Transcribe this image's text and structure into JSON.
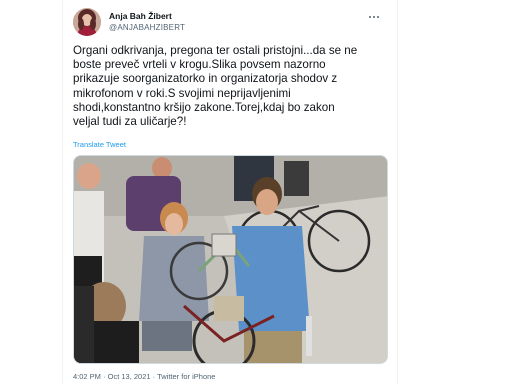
{
  "tweet": {
    "author": {
      "display_name": "Anja Bah Žibert",
      "handle": "@ANJABAHZIBERT"
    },
    "text": "Organi odkrivanja, pregona ter ostali pristojni...da se ne\nboste preveč vrteli v krogu.Slika povsem nazorno\nprikazuje soorganizatorko in organizatorja shodov z\nmikrofonom v roki.S svojimi neprijavljenimi\nshodi,konstantno kršijo zakone.Torej,kdaj bo zakon\nveljal tudi za uličarje?!",
    "translate_label": "Translate Tweet",
    "meta": {
      "time": "4:02 PM",
      "separator": " · ",
      "date": "Oct 13, 2021",
      "source": "Twitter for iPhone"
    }
  },
  "icons": {
    "more": "more-horizontal-icon",
    "avatar": "avatar"
  },
  "colors": {
    "link": "#1d9bf0",
    "secondary_text": "#536471",
    "primary_text": "#0f1419",
    "border": "#cfd9de"
  }
}
